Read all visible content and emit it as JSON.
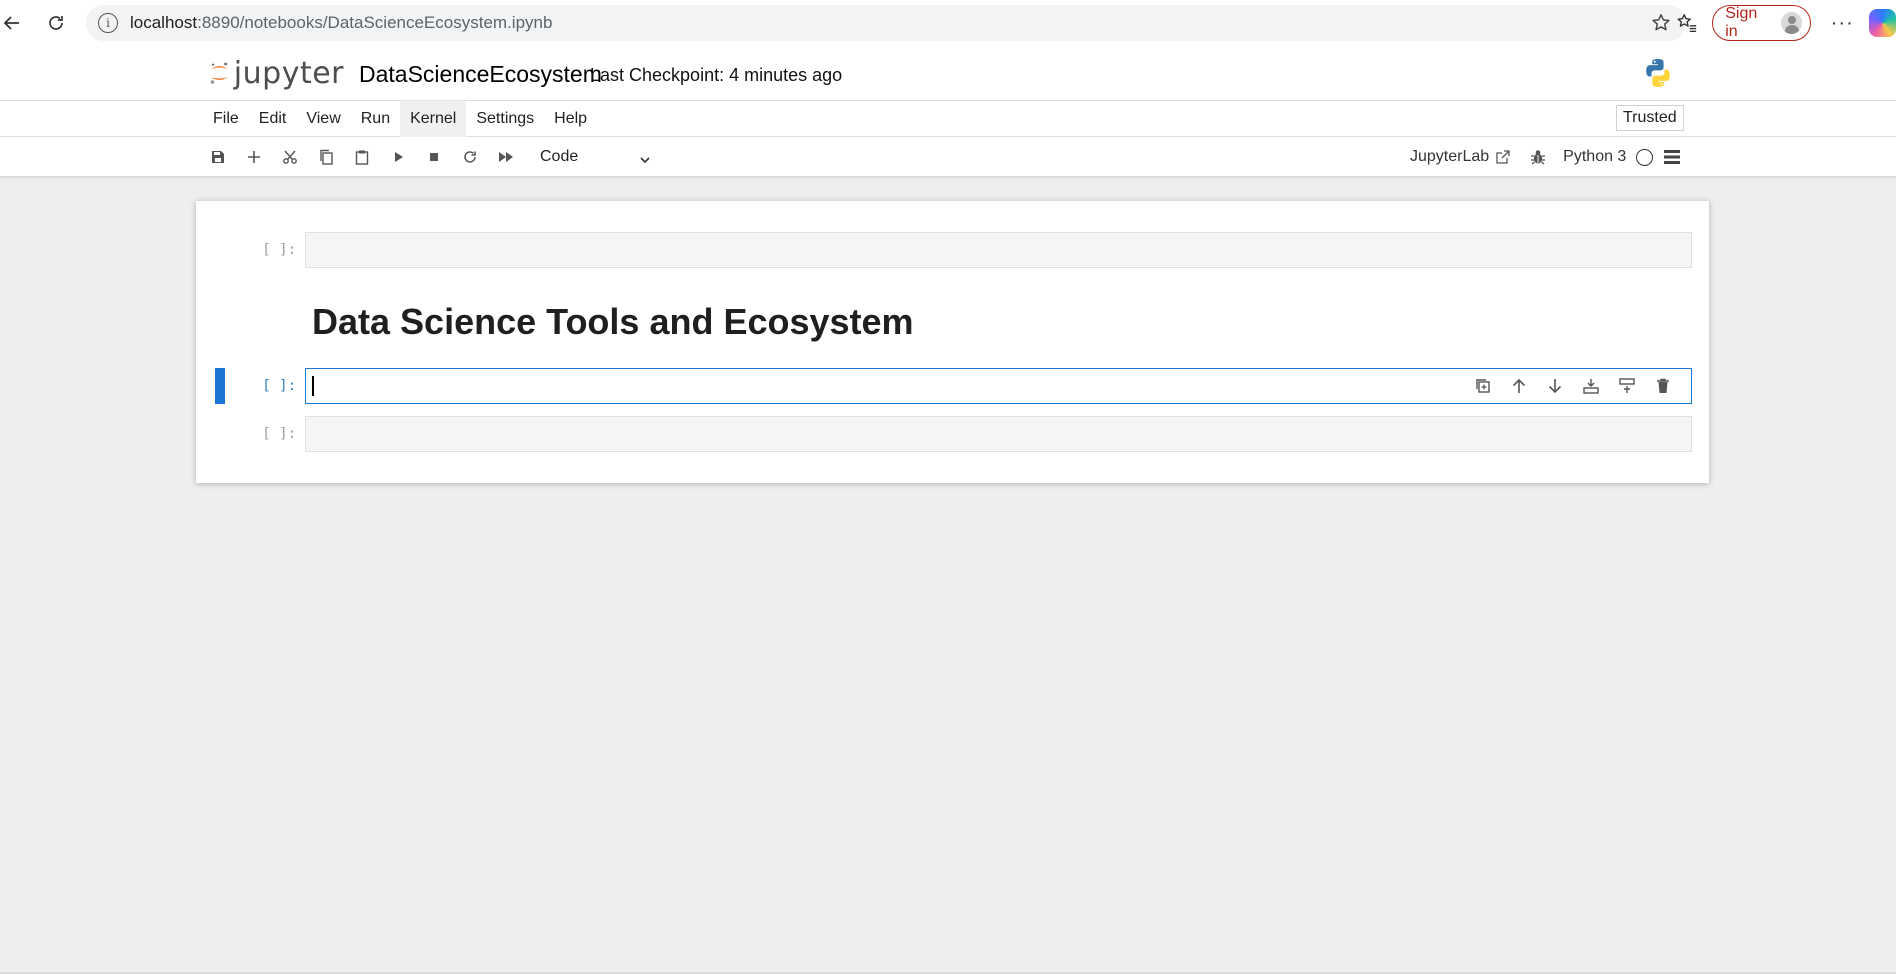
{
  "browser": {
    "url_host": "localhost",
    "url_path": ":8890/notebooks/DataScienceEcosystem.ipynb",
    "signin_label": "Sign in",
    "more_label": "···"
  },
  "header": {
    "logo_text": "jupyter",
    "notebook_title": "DataScienceEcosystem",
    "checkpoint": "Last Checkpoint: 4 minutes ago"
  },
  "menu": {
    "items": [
      "File",
      "Edit",
      "View",
      "Run",
      "Kernel",
      "Settings",
      "Help"
    ],
    "trusted": "Trusted"
  },
  "toolbar": {
    "cell_type": "Code",
    "jupyterlab_label": "JupyterLab",
    "kernel_name": "Python 3"
  },
  "cells": [
    {
      "type": "code",
      "prompt": "[ ]:",
      "source": ""
    },
    {
      "type": "markdown",
      "rendered": "Data Science Tools and Ecosystem"
    },
    {
      "type": "code",
      "prompt": "[ ]:",
      "source": "",
      "active": true
    },
    {
      "type": "code",
      "prompt": "[ ]:",
      "source": ""
    }
  ],
  "colors": {
    "accent": "#1976d2",
    "jupyter_orange": "#f37726",
    "signin_red": "#b3261e",
    "page_bg": "#eeeeee"
  }
}
